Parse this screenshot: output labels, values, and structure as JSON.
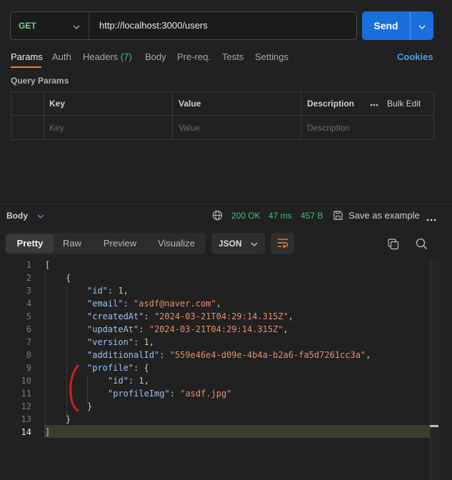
{
  "request": {
    "method": "GET",
    "url": "http://localhost:3000/users",
    "send_label": "Send"
  },
  "tabs": {
    "params": "Params",
    "auth": "Auth",
    "headers": "Headers",
    "headers_count": "(7)",
    "body": "Body",
    "prereq": "Pre-req.",
    "tests": "Tests",
    "settings": "Settings",
    "cookies": "Cookies"
  },
  "query_params": {
    "title": "Query Params",
    "columns": [
      "Key",
      "Value",
      "Description"
    ],
    "bulk_edit": "Bulk Edit",
    "placeholders": [
      "Key",
      "Value",
      "Description"
    ]
  },
  "response": {
    "body_label": "Body",
    "status": "200 OK",
    "time": "47 ms",
    "size": "457 B",
    "save_example": "Save as example",
    "views": [
      "Pretty",
      "Raw",
      "Preview",
      "Visualize"
    ],
    "format": "JSON"
  },
  "code": {
    "lines": [
      "1",
      "2",
      "3",
      "4",
      "5",
      "6",
      "7",
      "8",
      "9",
      "10",
      "11",
      "12",
      "13",
      "14"
    ],
    "l1": "[",
    "l2": "{",
    "l3_key": "\"id\"",
    "l3_val": "1",
    "l4_key": "\"email\"",
    "l4_val": "\"asdf@naver.com\"",
    "l5_key": "\"createdAt\"",
    "l5_val": "\"2024-03-21T04:29:14.315Z\"",
    "l6_key": "\"updateAt\"",
    "l6_val": "\"2024-03-21T04:29:14.315Z\"",
    "l7_key": "\"version\"",
    "l7_val": "1",
    "l8_key": "\"additionalId\"",
    "l8_val": "\"559e46e4-d09e-4b4a-b2a6-fa5d7261cc3a\"",
    "l9_key": "\"profile\"",
    "l10_key": "\"id\"",
    "l10_val": "1",
    "l11_key": "\"profileImg\"",
    "l11_val": "\"asdf.jpg\"",
    "l12": "}",
    "l13": "}",
    "l14": "]"
  },
  "colors": {
    "accent": "#1a6fdd",
    "status_green": "#3cc47a",
    "method_green": "#6fd08a",
    "annotation_red": "#d0201e"
  },
  "icons": [
    "chevron-down-icon",
    "globe-icon",
    "save-icon",
    "more-icon",
    "wrap-icon",
    "copy-icon",
    "search-icon"
  ]
}
